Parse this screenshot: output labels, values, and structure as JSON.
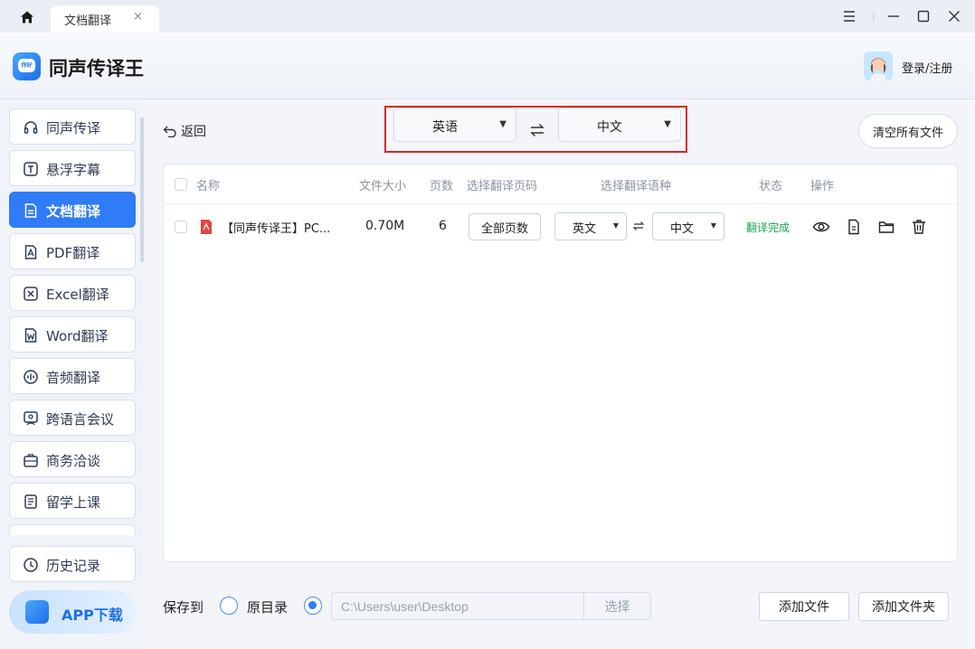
{
  "titlebar": {
    "tab_label": "文档翻译",
    "tab_close": "×"
  },
  "header": {
    "app_name": "同声传译王",
    "logo_text": "你好Hi",
    "login_label": "登录/注册"
  },
  "sidebar": {
    "items": [
      {
        "label": "同声传译",
        "icon": "headset-icon",
        "active": false
      },
      {
        "label": "悬浮字幕",
        "icon": "text-box-icon",
        "active": false
      },
      {
        "label": "文档翻译",
        "icon": "document-icon",
        "active": true
      },
      {
        "label": "PDF翻译",
        "icon": "pdf-icon",
        "active": false
      },
      {
        "label": "Excel翻译",
        "icon": "excel-icon",
        "active": false
      },
      {
        "label": "Word翻译",
        "icon": "word-icon",
        "active": false
      },
      {
        "label": "音频翻译",
        "icon": "audio-wave-icon",
        "active": false
      },
      {
        "label": "跨语言会议",
        "icon": "meeting-icon",
        "active": false
      },
      {
        "label": "商务洽谈",
        "icon": "briefcase-icon",
        "active": false
      },
      {
        "label": "留学上课",
        "icon": "notebook-icon",
        "active": false
      }
    ],
    "history_label": "历史记录",
    "app_download_label": "APP下载"
  },
  "toolbar": {
    "back_label": "返回",
    "source_lang": "英语",
    "target_lang": "中文",
    "clear_label": "清空所有文件"
  },
  "table": {
    "headers": {
      "name": "名称",
      "size": "文件大小",
      "pages": "页数",
      "page_select": "选择翻译页码",
      "lang_select": "选择翻译语种",
      "status": "状态",
      "actions": "操作"
    },
    "rows": [
      {
        "name": "【同声传译王】PC...",
        "size": "0.70M",
        "pages": "6",
        "page_select": "全部页数",
        "source_lang": "英文",
        "target_lang": "中文",
        "status": "翻译完成"
      }
    ]
  },
  "footer": {
    "save_to_label": "保存到",
    "option_original": "原目录",
    "path_value": "C:\\Users\\user\\Desktop",
    "choose_label": "选择",
    "add_file_label": "添加文件",
    "add_folder_label": "添加文件夹"
  },
  "colors": {
    "accent": "#2f7cf6",
    "highlight_frame": "#d9252b",
    "status_done": "#1aa34a"
  }
}
